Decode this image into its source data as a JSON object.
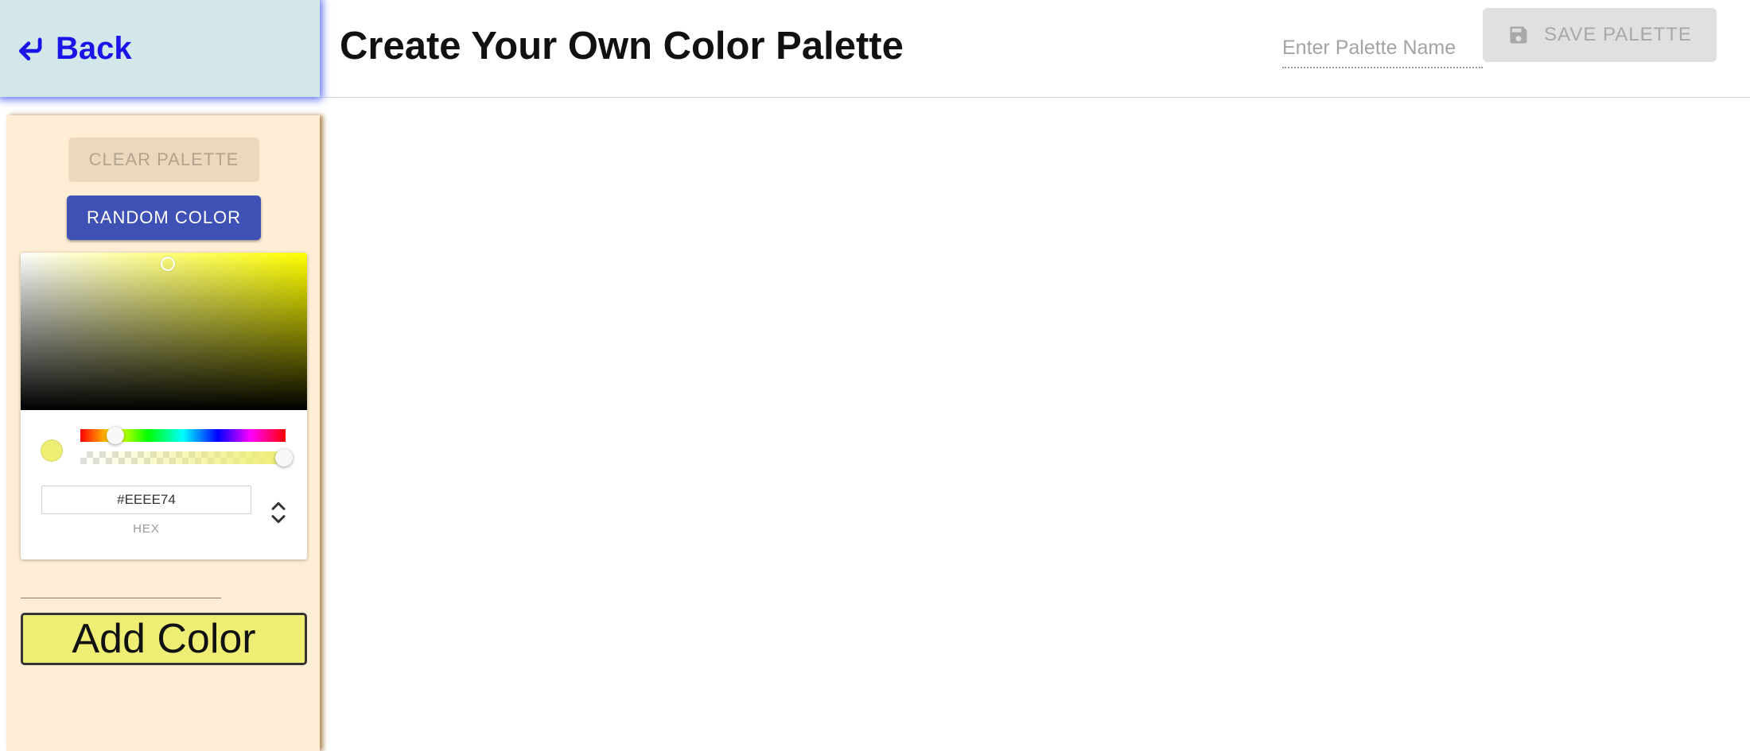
{
  "nav": {
    "back_label": "Back",
    "back_icon": "return-arrow-icon"
  },
  "header": {
    "title": "Create Your Own Color Palette",
    "palette_name_placeholder": "Enter Palette Name",
    "palette_name_value": "",
    "save_label": "SAVE PALETTE",
    "save_icon": "floppy-disk-icon"
  },
  "sidebar": {
    "clear_label": "CLEAR PALETTE",
    "random_label": "RANDOM COLOR",
    "picker": {
      "hex_value": "#EEEE74",
      "mode_label": "HEX",
      "current_color": "#EEEE74",
      "hue_level": 0.167,
      "alpha_level": 1.0
    },
    "add_label": "Add Color"
  },
  "colors": {
    "accent": "#3f51b5",
    "back_text": "#1a14e8",
    "back_panel_bg": "#d3e6ea",
    "sidebar_bg": "#ffeed5",
    "add_button_bg": "#eeee74"
  },
  "palette": []
}
